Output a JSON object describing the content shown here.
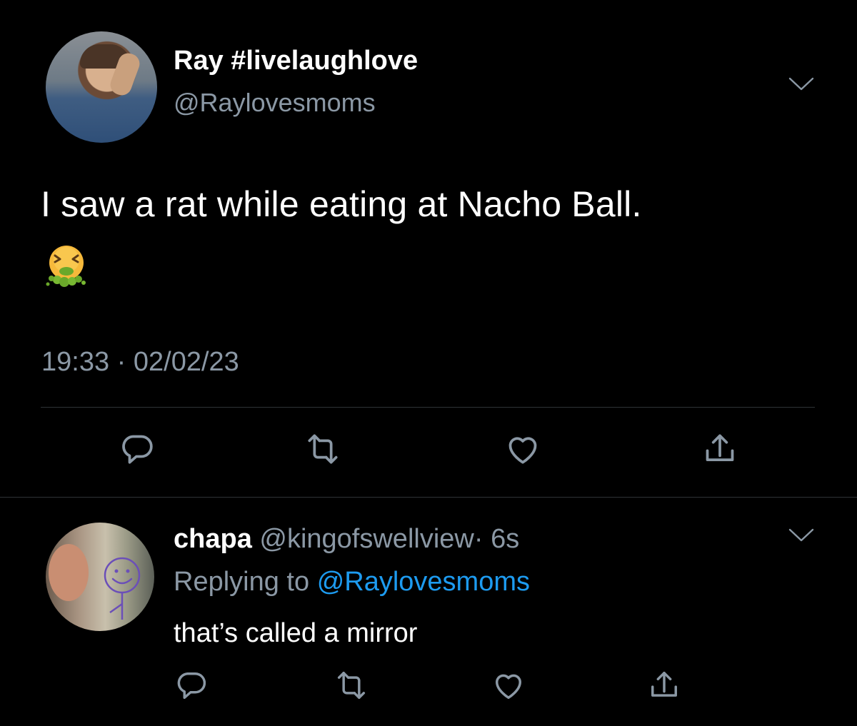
{
  "colors": {
    "background": "#000000",
    "text_primary": "#ffffff",
    "text_secondary": "#8b98a5",
    "link": "#1d9bf0",
    "divider": "#2f3336"
  },
  "tweet": {
    "display_name": "Ray #livelaughlove",
    "handle": "@Raylovesmoms",
    "text": "I saw a rat while eating at Nacho Ball.",
    "emoji": "face-vomiting-emoji",
    "timestamp": "19:33 · 02/02/23",
    "menu_icon": "chevron-down-icon",
    "actions": [
      "reply-icon",
      "retweet-icon",
      "like-icon",
      "share-icon"
    ]
  },
  "reply": {
    "display_name": "chapa",
    "handle": "@kingofswellview",
    "time": "· 6s",
    "replying_to_label": "Replying to",
    "replying_to_handle": "@Raylovesmoms",
    "text": "that’s called a mirror",
    "menu_icon": "chevron-down-icon",
    "actions": [
      "reply-icon",
      "retweet-icon",
      "like-icon",
      "share-icon"
    ]
  }
}
